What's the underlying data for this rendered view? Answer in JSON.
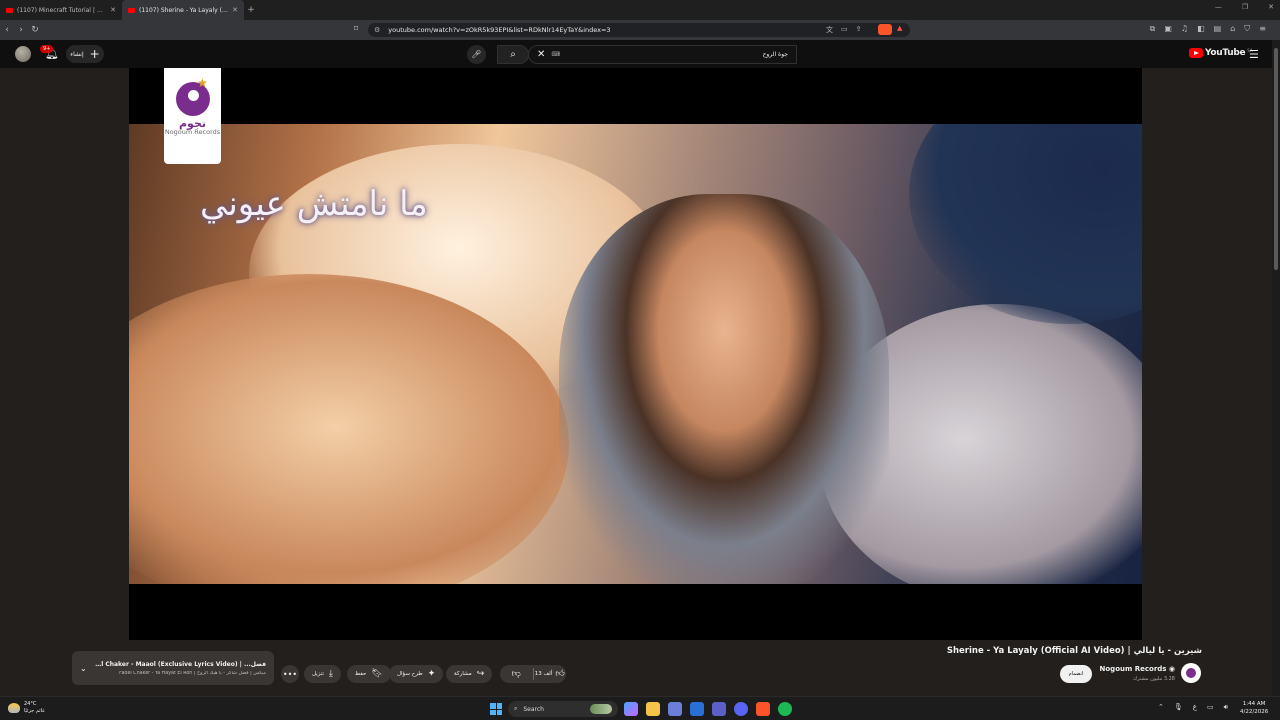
{
  "browser": {
    "tabs": [
      {
        "title": "(1107) Minecraft Tutorial | How to Bu",
        "active": false
      },
      {
        "title": "(1107) Sherine - Ya Layaly (Of",
        "active": true
      }
    ],
    "url": "youtube.com/watch?v=zOkR5k93EPI&list=RDkNlr14EyTaY&index=3"
  },
  "youtube": {
    "logo_text": "YouTube",
    "logo_region": "SA",
    "create_label": "إنشاء",
    "notification_count": "9+",
    "search": {
      "query": "جوة الروح",
      "keyboard_hint": "⌨"
    },
    "video": {
      "lyric": "ما نامتش عيوني",
      "logo_ar": "نجوم",
      "logo_en": "Nogoum Records",
      "title": "شيرين - يا ليالي | Sherine - Ya Layaly (Official AI Video)",
      "channel_name": "Nogoum Records",
      "subscribers": "3.28 مليون مشترك",
      "join_label": "انضمام",
      "likes": "13 ألف",
      "share_label": "مشاركة",
      "ask_label": "طرح سؤال",
      "save_label": "حفظ",
      "download_label": "تنزيل"
    },
    "mini_player": {
      "title": "فضل... | Fadel Chaker - Maaol (Exclusive Lyrics Video)",
      "subtitle": "ميكس | فضل شاكر - يا هيك الروح | Fadel Chaker - Ya Hayat El Roh"
    }
  },
  "taskbar": {
    "weather_temp": "24°C",
    "weather_desc": "غائم جزئيًا",
    "search_label": "Search",
    "lang": "ع",
    "time": "1:44 AM",
    "date": "4/22/2026"
  },
  "colors": {
    "yt_red": "#ff0000",
    "nogoum_purple": "#7a2d8c",
    "player_bg": "#221f1c"
  }
}
